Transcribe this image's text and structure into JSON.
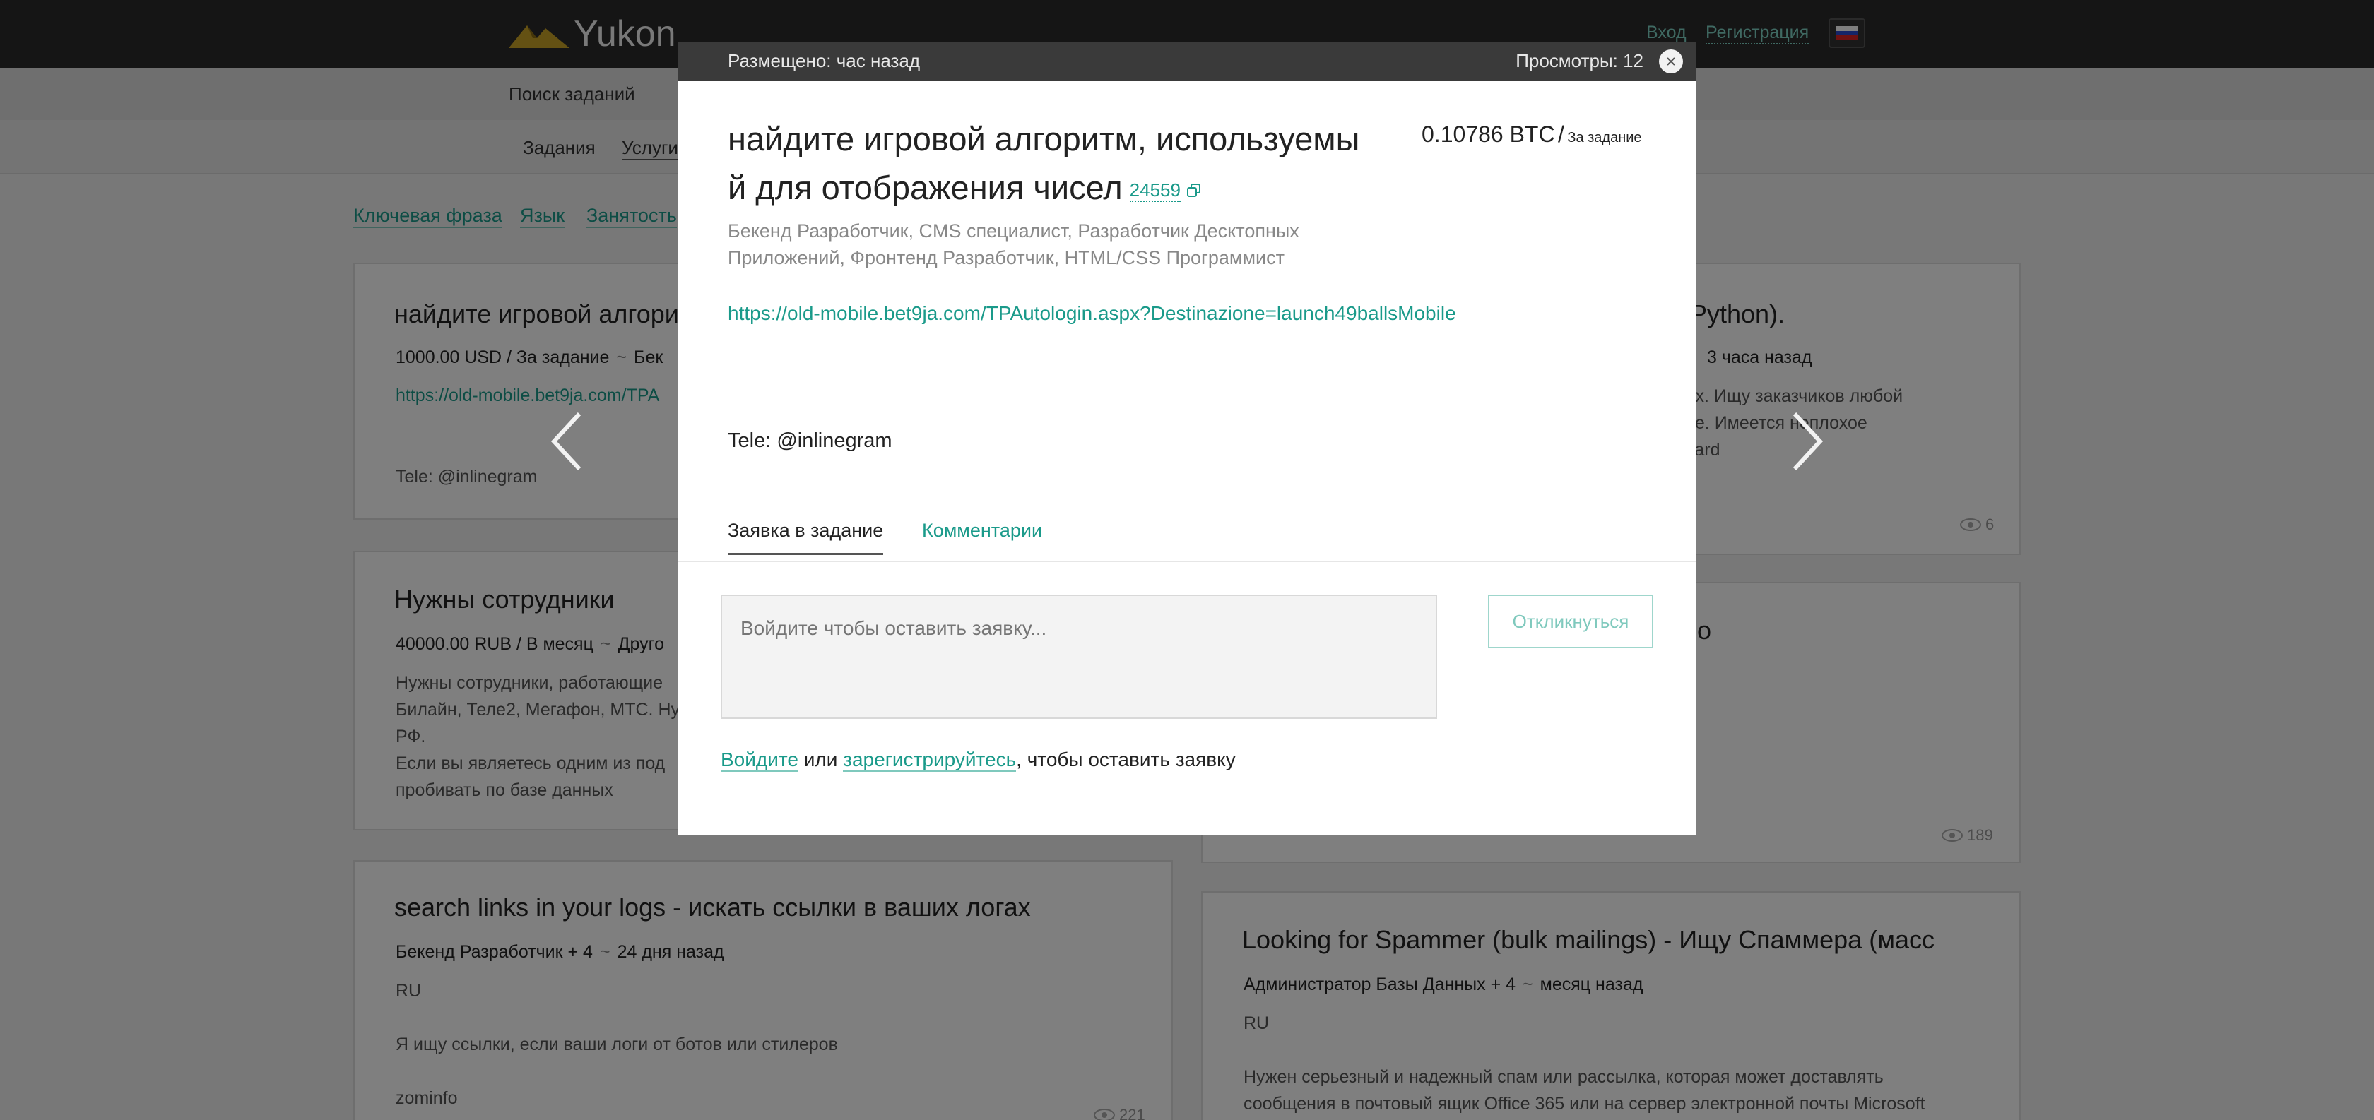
{
  "header": {
    "logo_text": "Yukon",
    "login": "Вход",
    "register": "Регистрация",
    "colors": {
      "accent": "#1a9a8a",
      "header_bg": "#2b2b2b",
      "logo_gold": "#c9a227"
    }
  },
  "search": {
    "label": "Поиск заданий"
  },
  "subnav": {
    "items": [
      "Задания",
      "Услуги"
    ]
  },
  "filters": [
    "Ключевая фраза",
    "Язык",
    "Занятость"
  ],
  "cards": [
    {
      "title": "найдите игровой алгори",
      "meta_price": "1000.00 USD / За задание",
      "meta_rest": "Бек",
      "link": "https://old-mobile.bet9ja.com/TPA",
      "contact": "Tele: @inlinegram"
    },
    {
      "title": "Python).",
      "meta_time": "3 часа назад",
      "text_lines": [
        "иях. Ищу заказчиков любой",
        "рве. Имеется неплохое",
        "dvard"
      ],
      "views": "6"
    },
    {
      "title": "Нужны сотрудники",
      "meta_price": "40000.00 RUB / В месяц",
      "meta_rest": "Друго",
      "text_lines": [
        "Нужны сотрудники, работающие",
        "Билайн, Теле2, Мегафон, МТС. Ну",
        "РФ.",
        "Если вы являетесь одним из под",
        "пробивать по базе данных"
      ]
    },
    {
      "title": "о",
      "views": "189"
    },
    {
      "title": "search links in your logs - искать ссылки в ваших логах",
      "meta_cat": "Бекенд Разработчик + 4",
      "meta_time": "24 дня назад",
      "lang": "RU",
      "text": "Я ищу ссылки, если ваши логи от ботов или стилеров",
      "author": "zominfo",
      "views": "221"
    },
    {
      "title": "Looking for Spammer (bulk mailings) - Ищу Спаммера (масс",
      "meta_cat": "Администратор Базы Данных + 4",
      "meta_time": "месяц назад",
      "lang": "RU",
      "text_lines": [
        "Нужен серьезный и надежный спам или рассылка, которая может доставлять",
        "сообщения в почтовый ящик Office 365 или на сервер электронной почты Microsoft"
      ]
    }
  ],
  "modal": {
    "posted": "Размещено: час назад",
    "views": "Просмотры: 12",
    "title_line1": "найдите игровой алгоритм, используемы",
    "title_line2": "й для отображения чисел",
    "task_id": "24559",
    "price": "0.10786 BTC",
    "price_sep": "/",
    "price_per": "За задание",
    "categories_line1": "Бекенд Разработчик, CMS специалист, Разработчик Десктопных",
    "categories_line2": "Приложений, Фронтенд Разработчик, HTML/CSS Программист",
    "link": "https://old-mobile.bet9ja.com/TPAutologin.aspx?Destinazione=launch49ballsMobile",
    "contact": "Tele: @inlinegram",
    "tabs": [
      "Заявка в задание",
      "Комментарии"
    ],
    "reply_placeholder": "Войдите чтобы оставить заявку...",
    "respond_button": "Откликнуться",
    "login_link": "Войдите",
    "or": "или",
    "register_link": "зарегистрируйтесь",
    "prompt_tail": ", чтобы оставить заявку"
  }
}
